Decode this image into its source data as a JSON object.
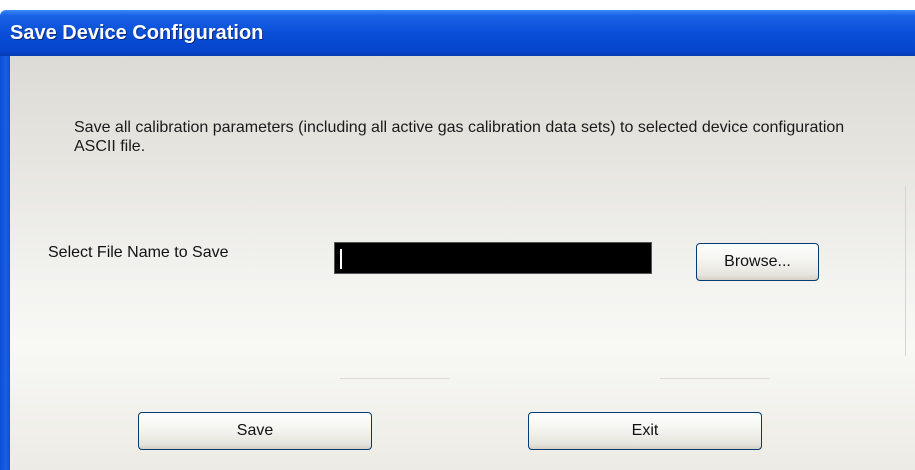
{
  "window": {
    "title": "Save Device Configuration"
  },
  "description": "Save all calibration parameters (including all active gas calibration data sets) to selected device configuration ASCII file.",
  "file": {
    "label": "Select File Name to Save",
    "value": "",
    "browse_label": "Browse..."
  },
  "actions": {
    "save_label": "Save",
    "exit_label": "Exit"
  },
  "colors": {
    "titlebar": "#0a4fd8",
    "input_background": "#000000"
  }
}
